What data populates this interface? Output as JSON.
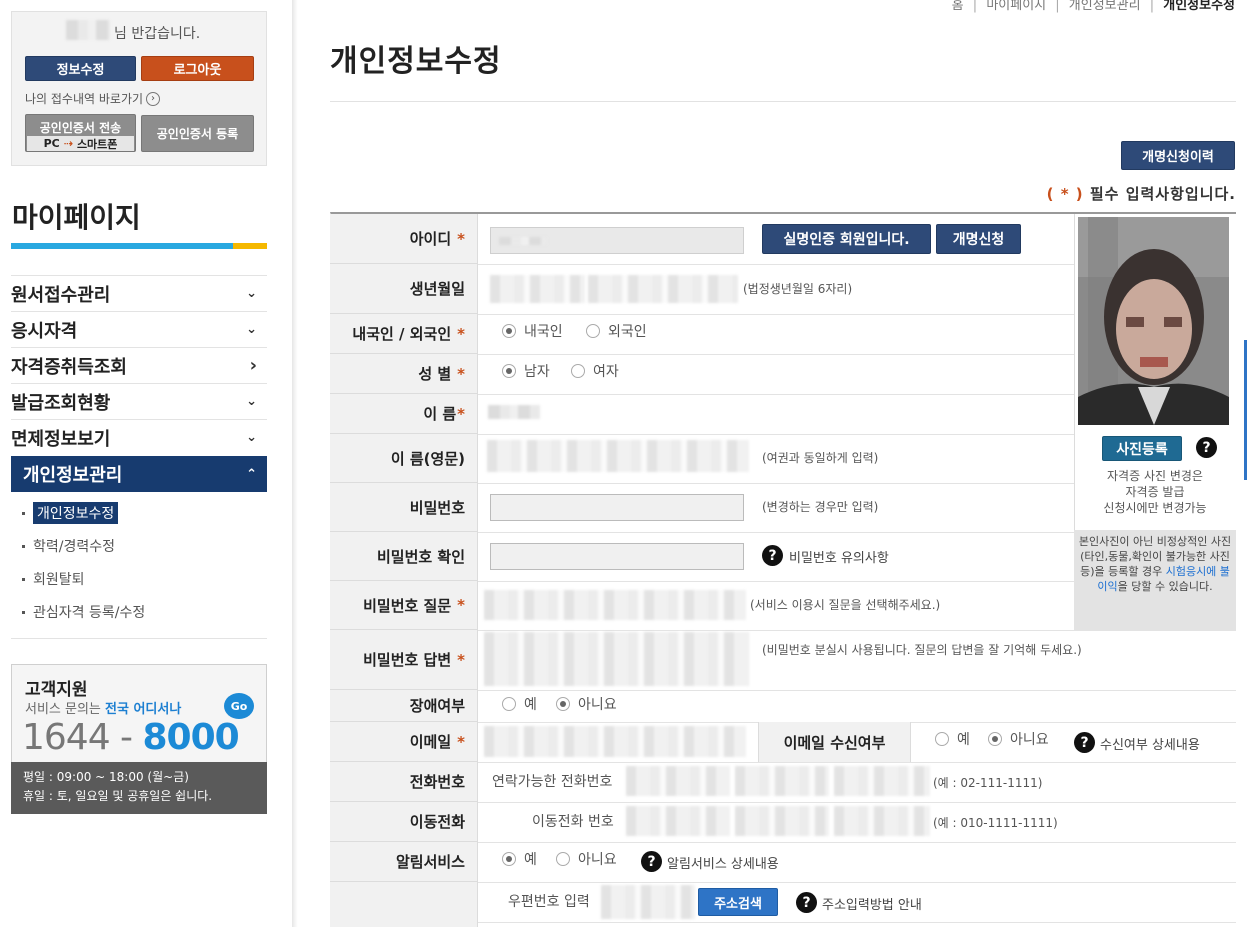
{
  "sidebar": {
    "welcome_suffix": "님 반갑습니다.",
    "edit_info_label": "정보수정",
    "logout_label": "로그아웃",
    "receipt_link": "나의 접수내역 바로가기",
    "cert_transfer_label": "공인인증서 전송",
    "cert_transfer_sub_pc": "PC",
    "cert_transfer_sub_phone": "스마트폰",
    "cert_register_label": "공인인증서 등록",
    "mypage_title": "마이페이지",
    "menu": [
      {
        "label": "원서접수관리",
        "chevron": "⌄"
      },
      {
        "label": "응시자격",
        "chevron": "⌄"
      },
      {
        "label": "자격증취득조회",
        "chevron": "›"
      },
      {
        "label": "발급조회현황",
        "chevron": "⌄"
      },
      {
        "label": "면제정보보기",
        "chevron": "⌄"
      },
      {
        "label": "개인정보관리",
        "chevron": "⌃"
      }
    ],
    "submenu": [
      {
        "label": "개인정보수정"
      },
      {
        "label": "학력/경력수정"
      },
      {
        "label": "회원탈퇴"
      },
      {
        "label": "관심자격 등록/수정"
      }
    ],
    "support": {
      "title": "고객지원",
      "desc_prefix": "서비스 문의는 ",
      "desc_highlight": "전국 어디서나",
      "go_badge": "Go",
      "phone_prefix": "1644 - ",
      "phone_suffix": "8000",
      "hours_weekday": "평일 : 09:00 ~ 18:00 (월~금)",
      "hours_holiday": "휴일 : 토, 일요일 및 공휴일은 쉽니다."
    }
  },
  "breadcrumb": {
    "items": [
      "홈",
      "마이페이지",
      "개인정보관리"
    ],
    "current": "개인정보수정"
  },
  "page_title": "개인정보수정",
  "rename_history_label": "개명신청이력",
  "required_note_star": "( * )",
  "required_note_text": " 필수 입력사항입니다.",
  "form": {
    "id_label": "아이디",
    "realname_btn": "실명인증 회원입니다.",
    "rename_btn": "개명신청",
    "birth_label": "생년월일",
    "birth_hint": "(법정생년월일 6자리)",
    "nation_label": "내국인 / 외국인",
    "nation_options": [
      "내국인",
      "외국인"
    ],
    "gender_label": "성 별",
    "gender_options": [
      "남자",
      "여자"
    ],
    "name_label": "이 름",
    "name_en_label": "이 름(영문)",
    "name_en_hint": "(여권과 동일하게 입력)",
    "pw_label": "비밀번호",
    "pw_hint": "(변경하는 경우만 입력)",
    "pw_confirm_label": "비밀번호 확인",
    "pw_caution": "비밀번호 유의사항",
    "pw_question_label": "비밀번호 질문",
    "pw_question_hint": "(서비스 이용시 질문을 선택해주세요.)",
    "pw_answer_label": "비밀번호 답변",
    "pw_answer_hint": "(비밀번호 분실시 사용됩니다. 질문의 답변을 잘 기억해 두세요.)",
    "disability_label": "장애여부",
    "yes_no": [
      "예",
      "아니요"
    ],
    "email_label": "이메일",
    "email_receive_label": "이메일 수신여부",
    "email_receive_detail": "수신여부 상세내용",
    "phone_label": "전화번호",
    "phone_placeholder": "연락가능한 전화번호",
    "phone_hint": "(예 : 02-111-1111)",
    "mobile_label": "이동전화",
    "mobile_placeholder": "이동전화 번호",
    "mobile_hint": "(예 : 010-1111-1111)",
    "alarm_label": "알림서비스",
    "alarm_detail": "알림서비스 상세내용",
    "zip_placeholder": "우편번호 입력",
    "addr_search_btn": "주소검색",
    "addr_guide": "주소입력방법 안내",
    "required_mark": "*",
    "help_mark": "?"
  },
  "photo": {
    "register_btn": "사진등록",
    "change_note_1": "자격증 사진 변경은",
    "change_note_2": "자격증 발급",
    "change_note_3": "신청시에만 변경가능",
    "warning_prefix": "본인사진이 아닌 비정상적인 사진(타인,동물,확인이 불가능한 사진등)을 등록할 경우 ",
    "warning_highlight": "시험응시에 불이익",
    "warning_suffix": "을 당할 수 있습니다."
  },
  "colors": {
    "navy": "#2e4a78",
    "orange": "#c8501c",
    "active_menu": "#173b6f",
    "accent_blue": "#29a8e0",
    "accent_yellow": "#f5b800",
    "required": "#c8501c"
  }
}
